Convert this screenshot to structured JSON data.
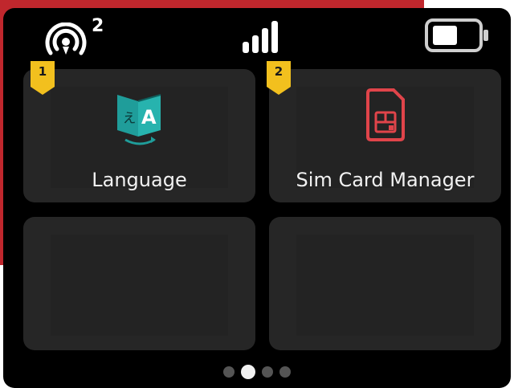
{
  "status": {
    "hotspot_icon": "hotspot-icon",
    "hotspot_count": "2",
    "signal_icon": "signal-bars-icon",
    "battery_icon": "battery-icon"
  },
  "tiles": [
    {
      "badge": "1",
      "label": "Language",
      "icon": "translate-icon",
      "icon_color": "#1f9d9a"
    },
    {
      "badge": "2",
      "label": "Sim Card Manager",
      "icon": "sim-card-icon",
      "icon_color": "#e0444a"
    },
    {
      "badge": "",
      "label": "",
      "icon": ""
    },
    {
      "badge": "",
      "label": "",
      "icon": ""
    }
  ],
  "pagination": {
    "pages": 4,
    "active_page": 2
  },
  "colors": {
    "badge": "#f2c01e",
    "accent_red": "#c0272d",
    "teal": "#1f9d9a",
    "sim_red": "#e0444a"
  }
}
